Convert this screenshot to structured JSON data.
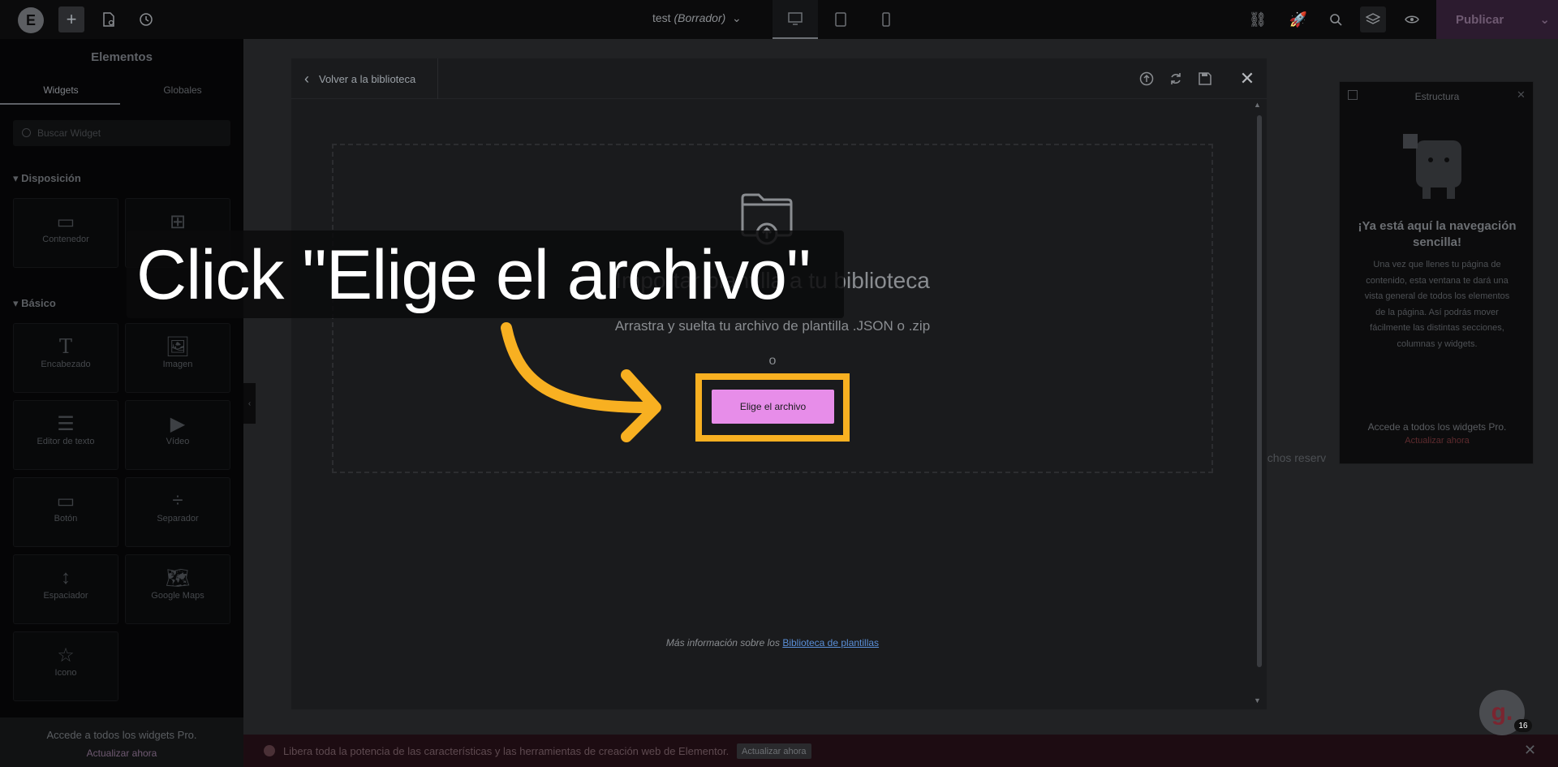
{
  "topbar": {
    "doc_name": "test",
    "doc_status": "(Borrador)",
    "publish_label": "Publicar"
  },
  "left_panel": {
    "title": "Elementos",
    "tabs": [
      "Widgets",
      "Globales"
    ],
    "search_placeholder": "Buscar Widget",
    "sections": [
      {
        "title": "Disposición",
        "widgets": [
          "Contenedor",
          ""
        ]
      },
      {
        "title": "Básico",
        "widgets": [
          "Encabezado",
          "Imagen",
          "Editor de texto",
          "Vídeo",
          "Botón",
          "Separador",
          "Espaciador",
          "Google Maps",
          "Icono"
        ]
      }
    ],
    "promo_text": "Accede a todos los widgets Pro.",
    "promo_link": "Actualizar ahora"
  },
  "canvas": {
    "footer_partial": "echos reserv"
  },
  "modal": {
    "back_label": "Volver a la biblioteca",
    "import_title": "Importar plantilla a tu biblioteca",
    "import_subtitle": "Arrastra y suelta tu archivo de plantilla .JSON o .zip",
    "or_text": "o",
    "choose_file_label": "Elige el archivo",
    "more_info_text": "Más información sobre los ",
    "more_info_link": "Biblioteca de plantillas"
  },
  "structure_panel": {
    "title": "Estructura",
    "heading": "¡Ya está aquí la navegación sencilla!",
    "body": "Una vez que llenes tu página de contenido, esta ventana te dará una vista general de todos los elementos de la página. Así podrás mover fácilmente las distintas secciones, columnas y widgets.",
    "promo_text": "Accede a todos los widgets Pro.",
    "promo_link": "Actualizar ahora"
  },
  "banner": {
    "text": "Libera toda la potencia de las características y las herramientas de creación web de Elementor.",
    "button_label": "Actualizar ahora"
  },
  "annotation": {
    "callout_text": "Click \"Elige el archivo\"",
    "highlight_color": "#f8b021"
  },
  "help_badge": {
    "letter": "g.",
    "count": "16"
  },
  "colors": {
    "accent": "#e78de9",
    "annotation": "#f8b021"
  }
}
